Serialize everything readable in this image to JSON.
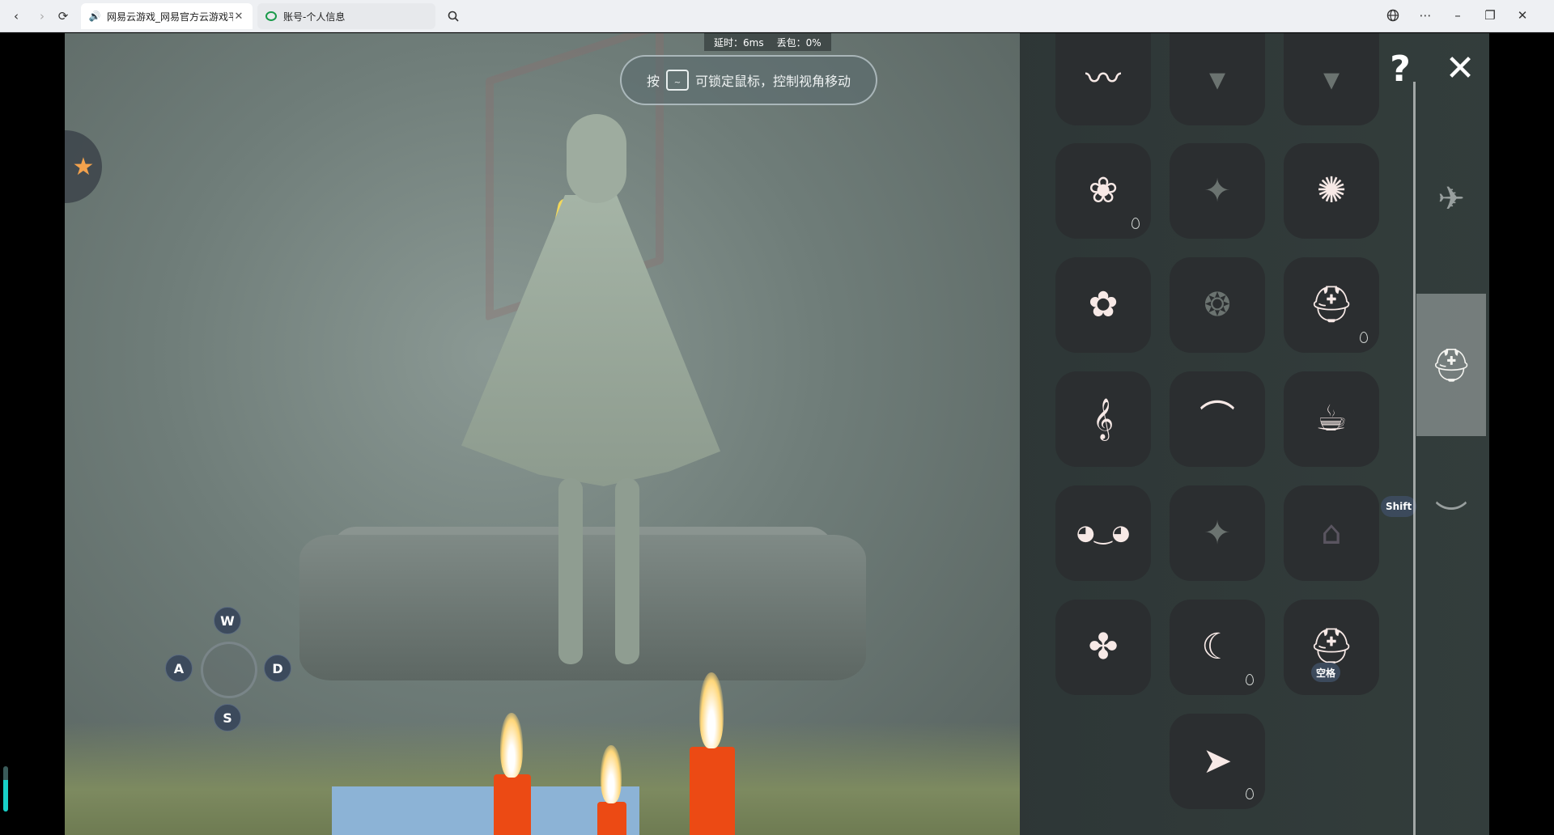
{
  "browser": {
    "tabs": [
      {
        "title": "网易云游戏_网易官方云游戏平",
        "active": true
      },
      {
        "title": "账号-个人信息",
        "active": false
      }
    ],
    "icons": {
      "back": "chevron-left-icon",
      "forward": "chevron-right-icon",
      "reload": "reload-icon",
      "search": "search-icon",
      "globe": "globe-icon",
      "more": "more-icon",
      "minimize": "minimize-icon",
      "restore": "restore-icon",
      "close": "close-icon"
    }
  },
  "game": {
    "status": {
      "latency": "延时：6ms",
      "packet_loss": "丢包：0%"
    },
    "hint": {
      "prefix": "按",
      "key": "~",
      "text": "可锁定鼠标，控制视角移动"
    },
    "controls": {
      "up": "W",
      "left": "A",
      "right": "D",
      "down": "S"
    },
    "panel": {
      "help": "?",
      "close": "✕",
      "shift_label": "Shift",
      "space_label": "空格",
      "slots": [
        {
          "glyph": "〰"
        },
        {
          "glyph": "▾"
        },
        {
          "glyph": "▾"
        },
        {
          "glyph": "❀"
        },
        {
          "glyph": "✦"
        },
        {
          "glyph": "✺"
        },
        {
          "glyph": "✿"
        },
        {
          "glyph": "❂"
        },
        {
          "glyph": "⛑"
        },
        {
          "glyph": "𝄞"
        },
        {
          "glyph": "⌒"
        },
        {
          "glyph": "☕"
        },
        {
          "glyph": "◕‿◕"
        },
        {
          "glyph": "✦"
        },
        {
          "glyph": "⌂"
        },
        {
          "glyph": "✤"
        },
        {
          "glyph": "☾"
        },
        {
          "glyph": "⛑"
        },
        {
          "glyph": "➤"
        }
      ],
      "categories": [
        {
          "glyph": "✈"
        },
        {
          "glyph": "⛑"
        },
        {
          "glyph": "︶"
        }
      ]
    }
  }
}
